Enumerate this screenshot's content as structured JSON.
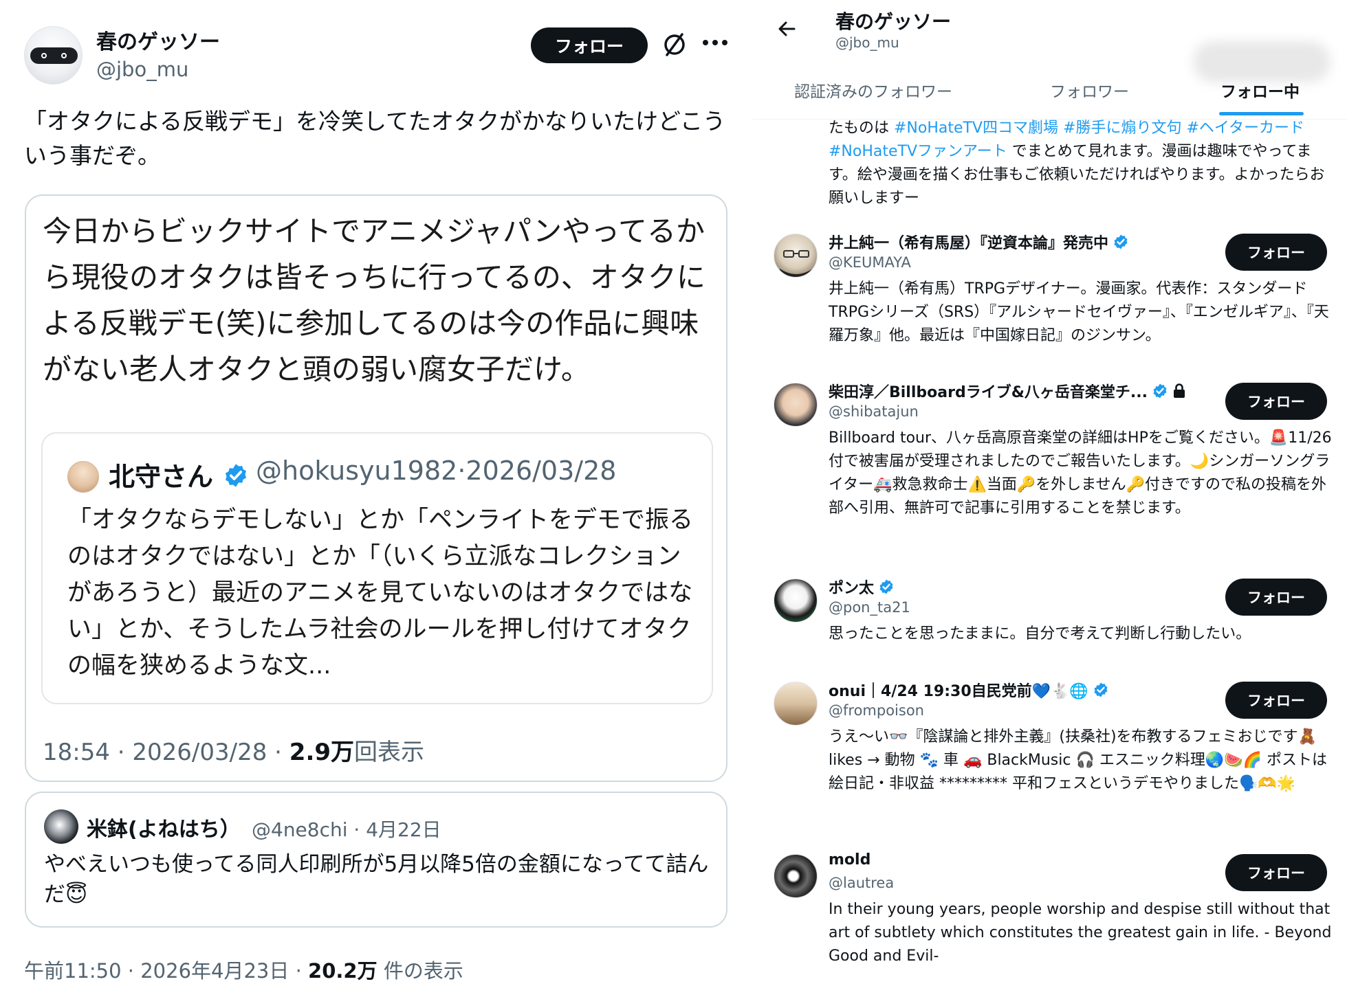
{
  "left": {
    "author": {
      "name": "春のゲッソー",
      "handle": "@jbo_mu"
    },
    "follow_label": "フォロー",
    "post_text": "「オタクによる反戦デモ」を冷笑してたオタクがかなりいたけどこういう事だぞ。",
    "quote_image": {
      "text": "今日からビックサイトでアニメジャパンやってるから現役のオタクは皆そっちに行ってるの、オタクによる反戦デモ(笑)に参加してるのは今の作品に興味がない老人オタクと頭の弱い腐女子だけ。",
      "inner": {
        "name": "北守さん",
        "meta": "@hokusyu1982·2026/03/28",
        "body": "「オタクならデモしない」とか「ペンライトをデモで振るのはオタクではない」とか「（いくら立派なコレクションがあろうと）最近のアニメを見ていないのはオタクではない」とか、そうしたムラ社会のルールを押し付けてオタクの幅を狭めるような文..."
      },
      "stats_time": "18:54 · 2026/03/28 · ",
      "stats_views": "2.9万",
      "stats_suffix": "回表示"
    },
    "reply": {
      "name": "米鉢(よねはち）",
      "meta": "@4ne8chi · 4月22日",
      "body": "やべえいつも使ってる同人印刷所が5月以降5倍の金額になってて詰んだ😇"
    },
    "stats": {
      "time": "午前11:50 · 2026年4月23日 · ",
      "views": "20.2万",
      "suffix": " 件の表示"
    }
  },
  "right": {
    "header": {
      "title": "春のゲッソー",
      "handle": "@jbo_mu"
    },
    "tabs": [
      "認証済みのフォロワー",
      "フォロワー",
      "フォロー中"
    ],
    "top_bio": {
      "p1": "たものは ",
      "tag1": "#NoHateTV四コマ劇場 #勝手に煽り文句 #ヘイターカード #NoHateTVファンアート",
      "p2": " でまとめて見れます。漫画は趣味でやってます。絵や漫画を描くお仕事もご依頼いただければやります。よかったらお願いしますー"
    },
    "button_label": "フォロー",
    "users": [
      {
        "name": "井上純一（希有馬屋）『逆資本論』発売中",
        "handle": "@KEUMAYA",
        "bio": "井上純一（希有馬）TRPGデザイナー。漫画家。代表作：スタンダードTRPGシリーズ（SRS）『アルシャードセイヴァー』、『エンゼルギア』、『天羅万象』他。最近は『中国嫁日記』のジンサン。"
      },
      {
        "name": "柴田淳／Billboardライブ&八ヶ岳音楽堂チ...",
        "handle": "@shibatajun",
        "bio": "Billboard tour、八ヶ岳高原音楽堂の詳細はHPをご覧ください。🚨11/26付で被害届が受理されましたのでご報告いたします。🌙シンガーソングライター🚑救急救命士⚠️当面🔑を外しません🔑付きですので私の投稿を外部へ引用、無許可で記事に引用することを禁じます。"
      },
      {
        "name": "ポン太",
        "handle": "@pon_ta21",
        "bio": "思ったことを思ったままに。自分で考えて判断し行動したい。"
      },
      {
        "name": "onui｜4/24 19:30自民党前💙🐇🌐",
        "handle": "@frompoison",
        "bio": "うえ〜い👓『陰謀論と排外主義』(扶桑社)を布教するフェミおじです🧸 likes → 動物 🐾 車 🚗 BlackMusic 🎧 エスニック料理🌏🍉🌈 ポストは絵日記・非収益 ********* 平和フェスというデモやりました🗣️🫶🌟"
      },
      {
        "name": "mold",
        "handle": "@lautrea",
        "bio": "In their young years, people worship and despise still without that art of subtlety which constitutes the greatest gain in life. - Beyond Good and Evil-"
      }
    ]
  }
}
